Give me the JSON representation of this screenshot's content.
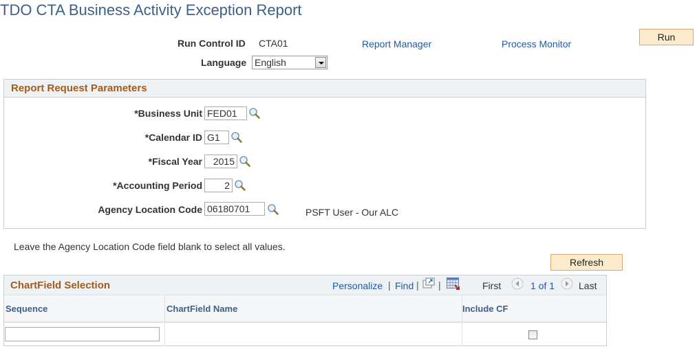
{
  "page": {
    "title": "TDO CTA Business Activity Exception Report"
  },
  "run_control": {
    "label": "Run Control ID",
    "value": "CTA01",
    "report_manager_link": "Report Manager",
    "process_monitor_link": "Process Monitor",
    "run_button": "Run",
    "language_label": "Language",
    "language_value": "English"
  },
  "parameters": {
    "title": "Report Request Parameters",
    "fields": [
      {
        "label": "*Business Unit",
        "value": "FED01",
        "icon": "lookup-icon"
      },
      {
        "label": "*Calendar ID",
        "value": "G1",
        "icon": "lookup-icon"
      },
      {
        "label": "*Fiscal Year",
        "value": "2015",
        "icon": "lookup-icon"
      },
      {
        "label": "*Accounting Period",
        "value": "2",
        "icon": "lookup-icon"
      },
      {
        "label": "Agency Location Code",
        "value": "06180701",
        "icon": "lookup-icon",
        "description": "PSFT User - Our ALC"
      }
    ]
  },
  "hint": "Leave the Agency Location Code field blank to select all values.",
  "refresh_button": "Refresh",
  "chartfield_grid": {
    "title": "ChartField Selection",
    "personalize": "Personalize",
    "find": "Find",
    "separator": "|",
    "view_all_icon": "new-window-icon",
    "download_icon": "download-spreadsheet-icon",
    "first": "First",
    "page_info": "1 of 1",
    "last": "Last",
    "columns": [
      "Sequence",
      "ChartField Name",
      "Include CF"
    ],
    "rows": [
      {
        "sequence": "",
        "chartfield_name": "",
        "include_cf": false
      }
    ]
  }
}
